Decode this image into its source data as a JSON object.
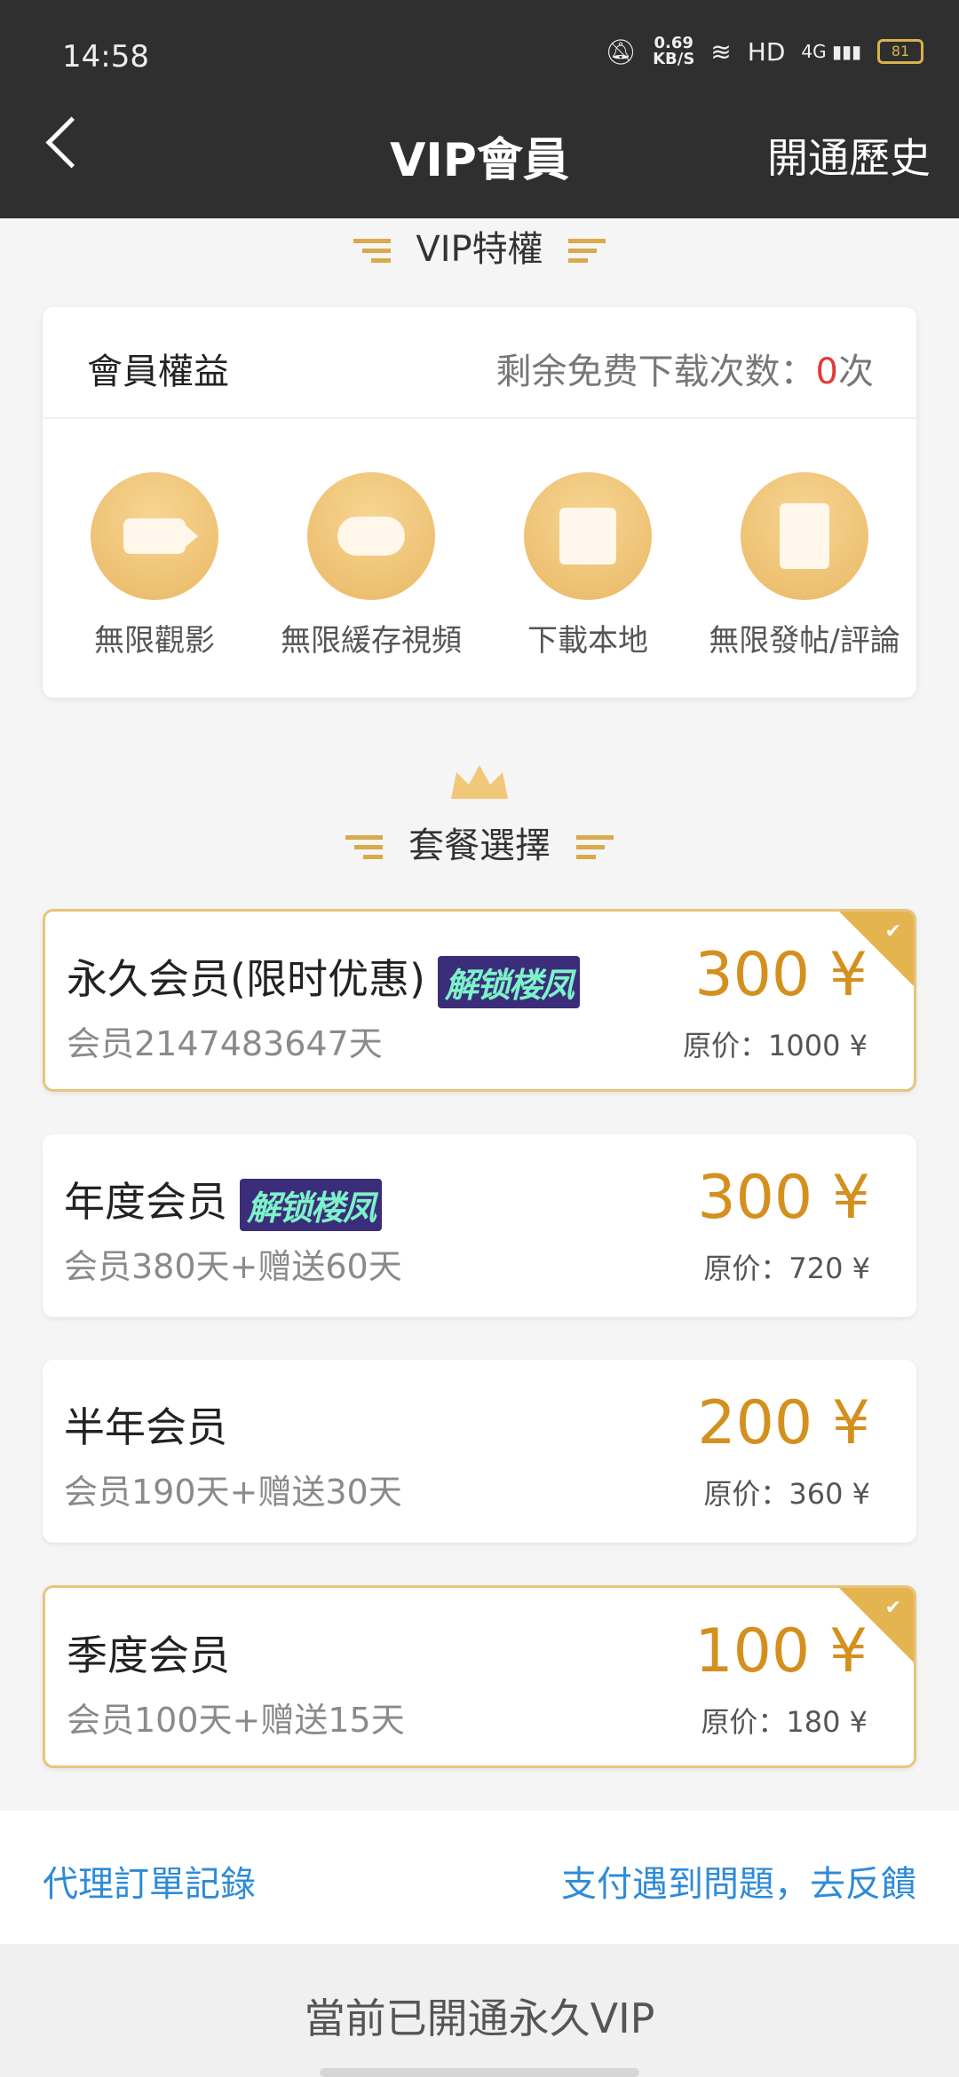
{
  "status_bar": {
    "time": "14:58",
    "speed": "0.69",
    "speed_unit": "KB/S",
    "hd": "HD",
    "net": "4G",
    "battery": "81"
  },
  "header": {
    "title": "VIP會員",
    "history": "開通歷史"
  },
  "vip_section": {
    "title": "VIP特權"
  },
  "benefits": {
    "title": "會員權益",
    "downloads_label": "剩余免费下载次数：",
    "downloads_count": "0",
    "downloads_unit": "次",
    "items": [
      {
        "label": "無限觀影",
        "icon": "video-icon"
      },
      {
        "label": "無限緩存視頻",
        "icon": "cloud-download-icon"
      },
      {
        "label": "下載本地",
        "icon": "download-icon"
      },
      {
        "label": "無限發帖/評論",
        "icon": "document-icon"
      }
    ]
  },
  "packages_section": {
    "title": "套餐選擇"
  },
  "packages": [
    {
      "name": "永久会员(限时优惠)",
      "tag": "解锁楼凤",
      "desc": "会员2147483647天",
      "price": "300 ¥",
      "original": "原价：1000 ¥",
      "selected": true
    },
    {
      "name": "年度会员",
      "tag": "解锁楼凤",
      "desc": "会员380天+赠送60天",
      "price": "300 ¥",
      "original": "原价：720 ¥",
      "selected": false
    },
    {
      "name": "半年会员",
      "tag": "",
      "desc": "会员190天+赠送30天",
      "price": "200 ¥",
      "original": "原价：360 ¥",
      "selected": false
    },
    {
      "name": "季度会员",
      "tag": "",
      "desc": "会员100天+赠送15天",
      "price": "100 ¥",
      "original": "原价：180 ¥",
      "selected": true
    }
  ],
  "footer": {
    "agent_orders": "代理訂單記錄",
    "feedback": "支付遇到問題，去反饋",
    "current_status": "當前已開通永久VIP"
  },
  "colors": {
    "accent": "#d4901f",
    "link": "#2e8bd8",
    "header_bg": "#2f2f2f",
    "gold": "#e3b44f"
  }
}
